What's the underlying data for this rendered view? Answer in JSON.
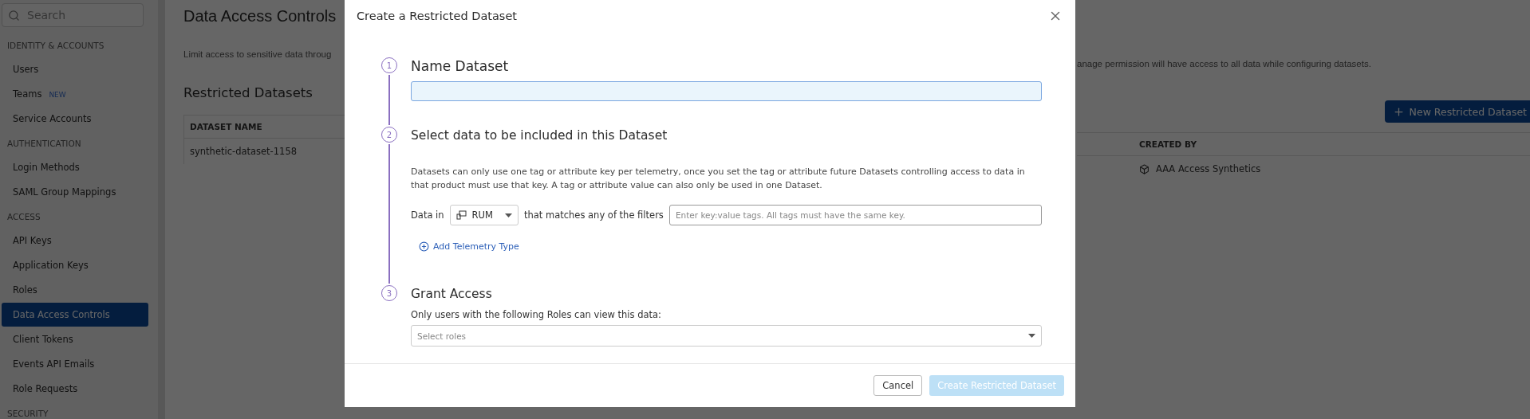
{
  "sidebar": {
    "search": {
      "placeholder": "Search"
    },
    "sections": [
      {
        "title": "IDENTITY & ACCOUNTS",
        "items": [
          {
            "label": "Users",
            "selected": false
          },
          {
            "label": "Teams",
            "badge": "NEW",
            "selected": false
          },
          {
            "label": "Service Accounts",
            "selected": false
          }
        ]
      },
      {
        "title": "AUTHENTICATION",
        "items": [
          {
            "label": "Login Methods",
            "selected": false
          },
          {
            "label": "SAML Group Mappings",
            "selected": false
          }
        ]
      },
      {
        "title": "ACCESS",
        "items": [
          {
            "label": "API Keys",
            "selected": false
          },
          {
            "label": "Application Keys",
            "selected": false
          },
          {
            "label": "Roles",
            "selected": false
          },
          {
            "label": "Data Access Controls",
            "selected": true
          },
          {
            "label": "Client Tokens",
            "selected": false
          },
          {
            "label": "Events API Emails",
            "selected": false
          },
          {
            "label": "Role Requests",
            "selected": false
          }
        ]
      },
      {
        "title": "SECURITY"
      }
    ]
  },
  "page": {
    "title": "Data Access Controls",
    "intro_left": "Limit access to sensitive data throug",
    "intro_right": "anage permission will have access to all data while configuring datasets.",
    "section_title": "Restricted Datasets",
    "new_button": "New Restricted Dataset",
    "table": {
      "columns": [
        "DATASET NAME",
        "CREATED BY"
      ],
      "rows": [
        [
          "synthetic-dataset-1158",
          "AAA Access Synthetics"
        ]
      ]
    }
  },
  "dialog": {
    "title": "Create a Restricted Dataset",
    "steps": [
      {
        "number": "1",
        "title": "Name Dataset",
        "kind": "name",
        "field": {
          "focused": true
        }
      },
      {
        "number": "2",
        "title": "Select data to be included in this Dataset",
        "kind": "filter",
        "description": "Datasets can only use one tag or attribute key per telemetry, once you set the tag or attribute future Datasets controlling access to data in that product must use that key. A tag or attribute value can also only be used in one Dataset.",
        "prefix": "Data in",
        "product": "RUM",
        "connector": "that matches any of the filters",
        "placeholder": "Enter key:value tags. All tags must have the same key.",
        "add_link": "Add Telemetry Type"
      },
      {
        "number": "3",
        "title": "Grant Access",
        "kind": "roles",
        "description": "Only users with the following Roles can view this data:",
        "placeholder": "Select roles"
      }
    ],
    "buttons": [
      {
        "label": "Cancel",
        "kind": "secondary",
        "disabled": false
      },
      {
        "label": "Create Restricted Dataset",
        "kind": "primary",
        "disabled": true
      }
    ]
  }
}
